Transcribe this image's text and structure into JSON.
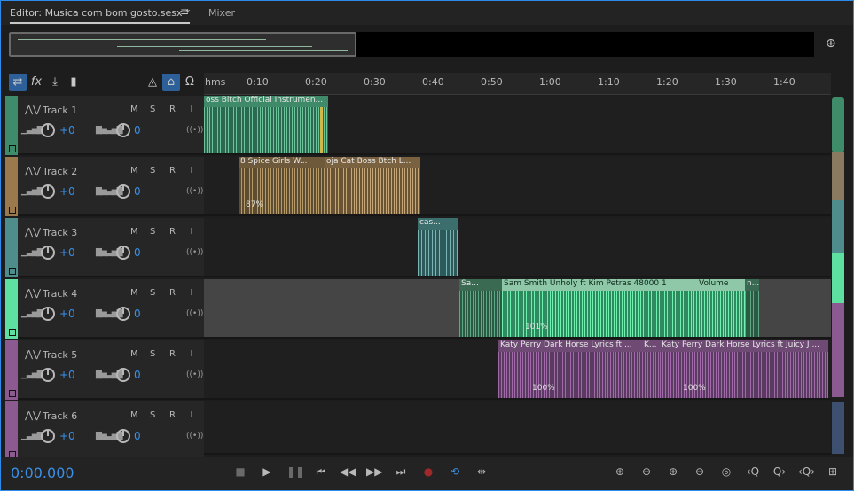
{
  "tabs": [
    {
      "label": "Editor: Musica com bom gosto.sesx *",
      "active": true
    },
    {
      "label": "Mixer",
      "active": false
    }
  ],
  "ruler": {
    "labels": [
      "hms",
      "0:10",
      "0:20",
      "0:30",
      "0:40",
      "0:50",
      "1:00",
      "1:10",
      "1:20",
      "1:30",
      "1:40"
    ]
  },
  "tracks": [
    {
      "name": "Track 1",
      "volume": "+0",
      "pan": "0",
      "m": "M",
      "s": "S",
      "r": "R",
      "i": "I",
      "color": "#3f8c6a"
    },
    {
      "name": "Track 2",
      "volume": "+0",
      "pan": "0",
      "m": "M",
      "s": "S",
      "r": "R",
      "i": "I",
      "color": "#9a7a4c"
    },
    {
      "name": "Track 3",
      "volume": "+0",
      "pan": "0",
      "m": "M",
      "s": "S",
      "r": "R",
      "i": "I",
      "color": "#4f8d8d"
    },
    {
      "name": "Track 4",
      "volume": "+0",
      "pan": "0",
      "m": "M",
      "s": "S",
      "r": "R",
      "i": "I",
      "color": "#5ee0a0"
    },
    {
      "name": "Track 5",
      "volume": "+0",
      "pan": "0",
      "m": "M",
      "s": "S",
      "r": "R",
      "i": "I",
      "color": "#8a5a90"
    },
    {
      "name": "Track 6",
      "volume": "+0",
      "pan": "0",
      "m": "M",
      "s": "S",
      "r": "R",
      "i": "I",
      "color": "#8a5a90"
    }
  ],
  "clips": {
    "t1c1": {
      "title": "oss Bitch Official Instrumen..."
    },
    "t2c1": {
      "title": "8 Spice Girls  W..."
    },
    "t2c2": {
      "title": "oja Cat  Boss Btch L..."
    },
    "t2c1_pct": "87%",
    "t3c1": {
      "title": "cas..."
    },
    "t4c1": {
      "title": "Sa..."
    },
    "t4c2": {
      "title": "Sam Smith  Unholy ft Kim Petras 48000 1"
    },
    "t4c2_param": "Volume",
    "t4c3": {
      "title": "n..."
    },
    "t4c2_pct": "101%",
    "t5c1": {
      "title": "Katy Perry  Dark Horse Lyrics ft ..."
    },
    "t5c2": {
      "title": "K..."
    },
    "t5c3": {
      "title": "Katy Perry  Dark Horse Lyrics ft Juicy J ..."
    },
    "t5c1_pct": "100%",
    "t5c3_pct": "100%"
  },
  "transport": {
    "time": "0:00.000"
  },
  "colors": {
    "accent": "#3a90e8",
    "track1": "#3f8c6a",
    "track2": "#9a7a4c",
    "track3": "#4f8d8d",
    "track4": "#5ee0a0",
    "track5": "#8a5a90"
  }
}
